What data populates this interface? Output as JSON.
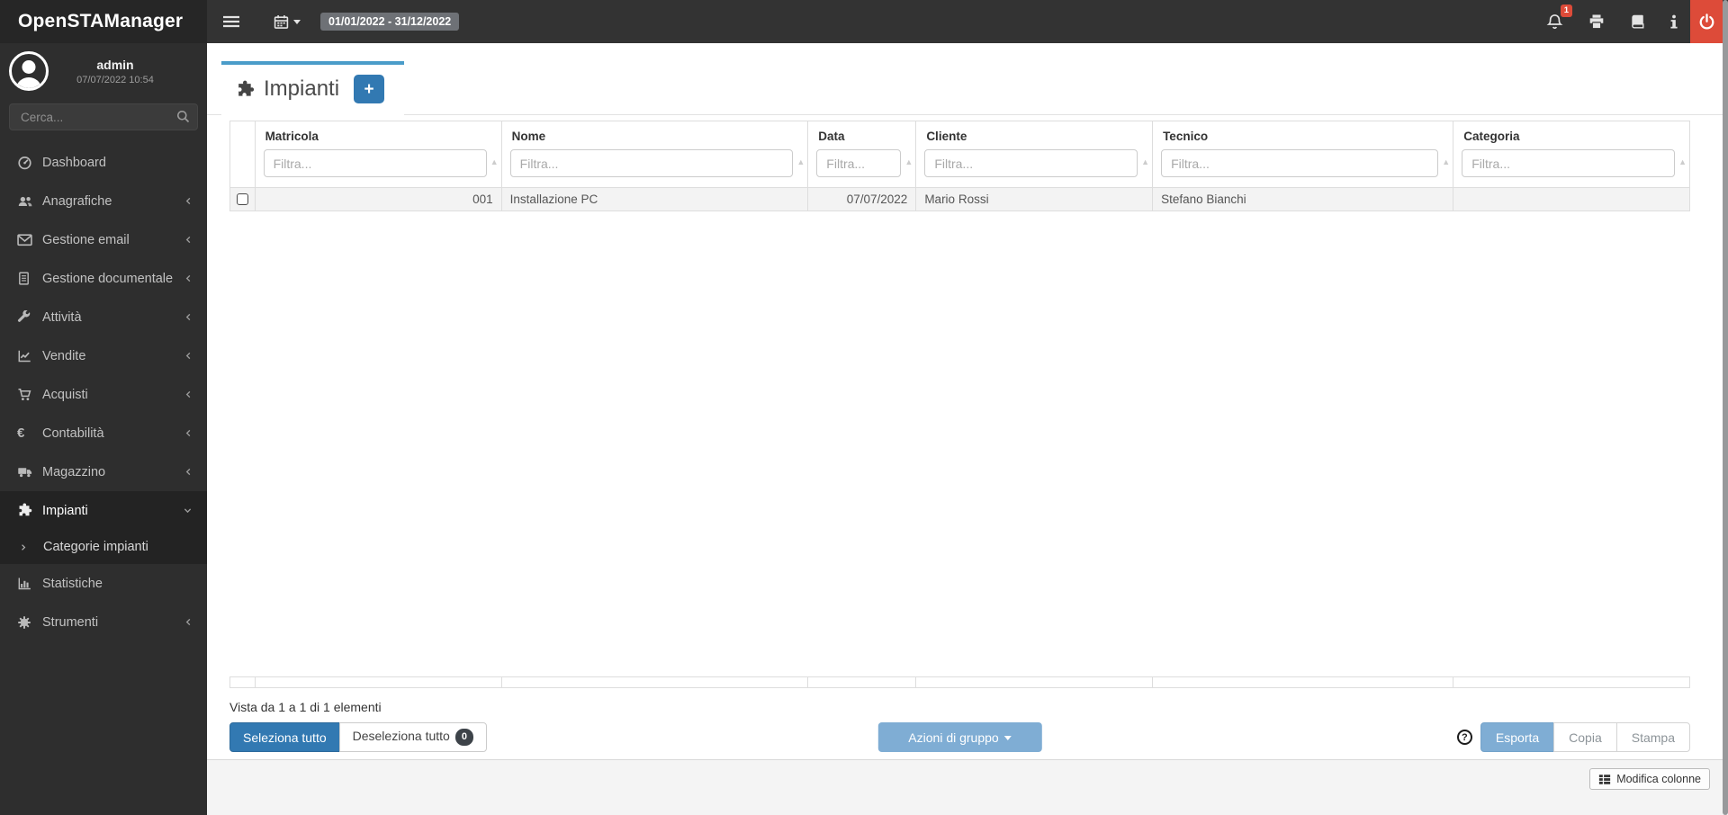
{
  "colors": {
    "accent": "#3279b2",
    "accent_light": "#7fadd4",
    "danger": "#dd4b39",
    "topbar": "#333333",
    "logo_bg": "#262626",
    "sidebar": "#2e2e2e",
    "active_bg": "#232323",
    "page_bg": "#f4f4f4",
    "row_bg": "#f3f3f3",
    "tab_border": "#4a9cc9",
    "border": "#dddddd"
  },
  "topbar": {
    "logo": "OpenSTAManager",
    "date_range": "01/01/2022 - 31/12/2022",
    "notification_count": "1"
  },
  "user": {
    "name": "admin",
    "datetime": "07/07/2022 10:54"
  },
  "sidebar": {
    "search_placeholder": "Cerca...",
    "items": [
      {
        "label": "Dashboard",
        "icon": "tachometer"
      },
      {
        "label": "Anagrafiche",
        "icon": "users",
        "chevron": "left"
      },
      {
        "label": "Gestione email",
        "icon": "envelope",
        "chevron": "left"
      },
      {
        "label": "Gestione documentale",
        "icon": "file",
        "chevron": "left"
      },
      {
        "label": "Attività",
        "icon": "wrench",
        "chevron": "left"
      },
      {
        "label": "Vendite",
        "icon": "chart-line",
        "chevron": "left"
      },
      {
        "label": "Acquisti",
        "icon": "cart",
        "chevron": "left"
      },
      {
        "label": "Contabilità",
        "icon": "euro",
        "chevron": "left"
      },
      {
        "label": "Magazzino",
        "icon": "truck",
        "chevron": "left"
      },
      {
        "label": "Impianti",
        "icon": "puzzle",
        "chevron": "down",
        "active": true
      },
      {
        "label": "Categorie impianti",
        "icon": "chevron-right",
        "submenu": true
      },
      {
        "label": "Statistiche",
        "icon": "bar-chart"
      },
      {
        "label": "Strumenti",
        "icon": "gear",
        "chevron": "left"
      }
    ]
  },
  "tab": {
    "title": "Impianti",
    "add_label": "+"
  },
  "table": {
    "columns": [
      {
        "label": "Matricola",
        "placeholder": "Filtra..."
      },
      {
        "label": "Nome",
        "placeholder": "Filtra..."
      },
      {
        "label": "Data",
        "placeholder": "Filtra..."
      },
      {
        "label": "Cliente",
        "placeholder": "Filtra..."
      },
      {
        "label": "Tecnico",
        "placeholder": "Filtra..."
      },
      {
        "label": "Categoria",
        "placeholder": "Filtra..."
      }
    ],
    "rows": [
      {
        "matricola": "001",
        "nome": "Installazione PC",
        "data": "07/07/2022",
        "cliente": "Mario Rossi",
        "tecnico": "Stefano Bianchi",
        "categoria": ""
      }
    ],
    "info": "Vista da 1 a 1 di 1 elementi"
  },
  "actions": {
    "select_all": "Seleziona tutto",
    "deselect_all": "Deseleziona tutto",
    "deselect_count": "0",
    "group_actions": "Azioni di gruppo",
    "export": "Esporta",
    "copy": "Copia",
    "print": "Stampa",
    "edit_columns": "Modifica colonne"
  }
}
